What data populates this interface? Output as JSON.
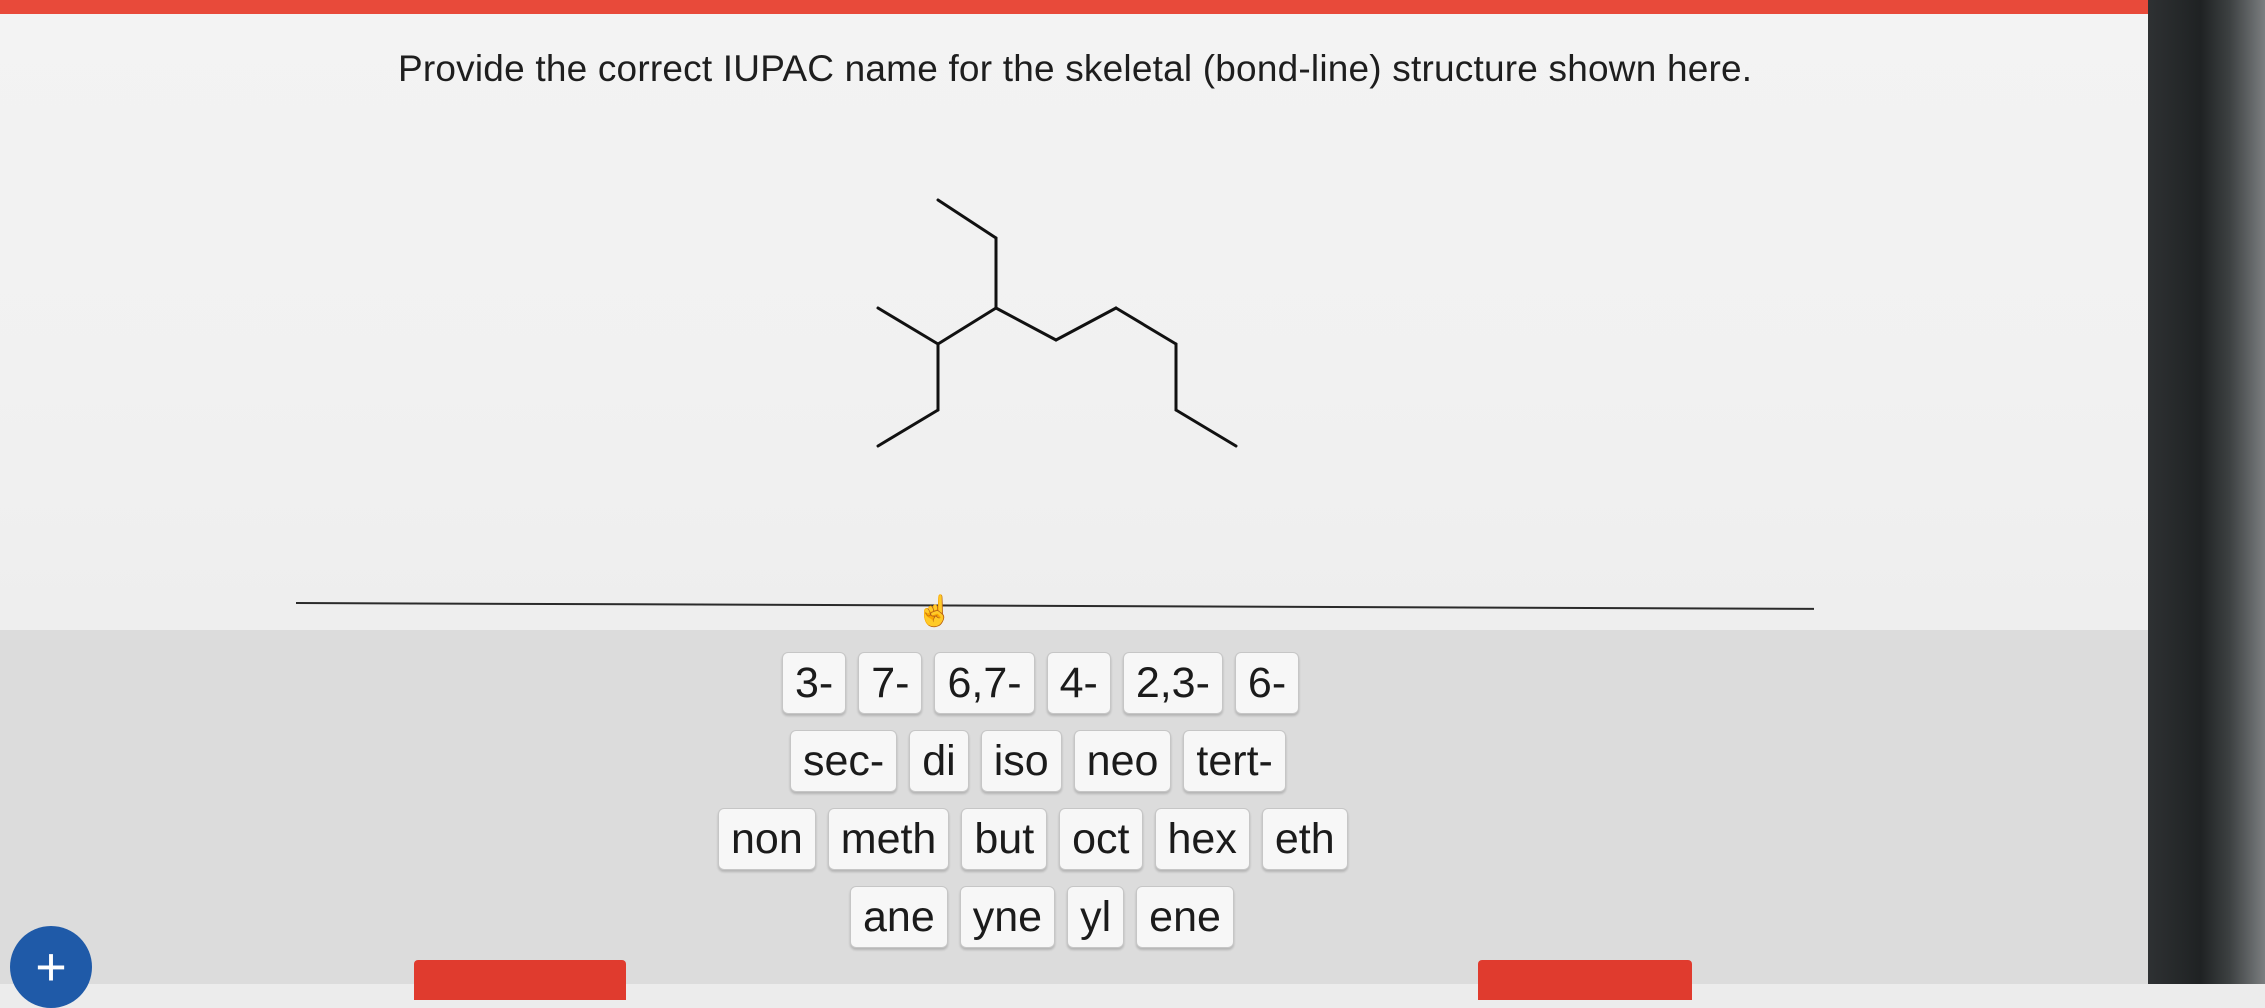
{
  "question": {
    "prompt": "Provide the correct IUPAC name for the skeletal (bond-line) structure shown here."
  },
  "tiles": {
    "locants": [
      "3-",
      "7-",
      "6,7-",
      "4-",
      "2,3-",
      "6-"
    ],
    "prefixes": [
      "sec-",
      "di",
      "iso",
      "neo",
      "tert-"
    ],
    "roots": [
      "non",
      "meth",
      "but",
      "oct",
      "hex",
      "eth"
    ],
    "suffixes": [
      "ane",
      "yne",
      "yl",
      "ene"
    ]
  },
  "icons": {
    "add": "+",
    "cursor": "hand-cursor-icon"
  },
  "colors": {
    "accent_bar": "#e84a3a",
    "add_button": "#1f5aa8",
    "action_button": "#e03b2e"
  }
}
